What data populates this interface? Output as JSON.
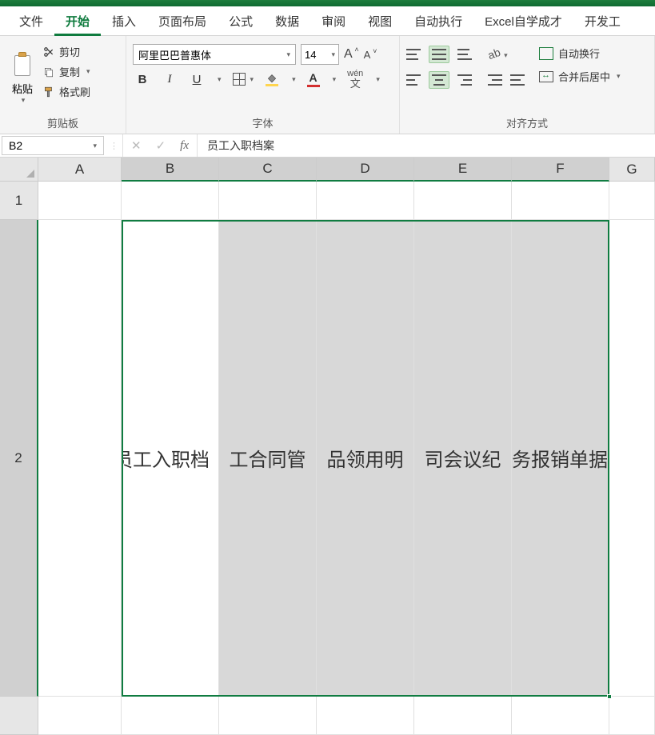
{
  "tabs": {
    "file": "文件",
    "home": "开始",
    "insert": "插入",
    "pageLayout": "页面布局",
    "formulas": "公式",
    "data": "数据",
    "review": "审阅",
    "view": "视图",
    "auto": "自动执行",
    "custom": "Excel自学成才",
    "dev": "开发工"
  },
  "clipboard": {
    "paste": "粘贴",
    "cut": "剪切",
    "copy": "复制",
    "formatPainter": "格式刷",
    "groupLabel": "剪贴板"
  },
  "font": {
    "name": "阿里巴巴普惠体",
    "size": "14",
    "groupLabel": "字体",
    "wen_top": "wén",
    "wen_bot": "文"
  },
  "alignment": {
    "wrap": "自动换行",
    "merge": "合并后居中",
    "groupLabel": "对齐方式"
  },
  "nameBox": "B2",
  "formula": "员工入职档案",
  "columns": [
    "A",
    "B",
    "C",
    "D",
    "E",
    "F",
    "G"
  ],
  "rows": [
    "1",
    "2"
  ],
  "cellData": {
    "B2": "员工入职档案",
    "C2": "员工合同管理",
    "D2": "办公用品领用明细",
    "E2": "公司会议纪要",
    "F2": "财务报销单据"
  },
  "cellDisplay": {
    "B2": "员工入职档",
    "C2": "工合同管",
    "D2": "品领用明",
    "E2": "司会议纪",
    "F2": "务报销单据"
  }
}
